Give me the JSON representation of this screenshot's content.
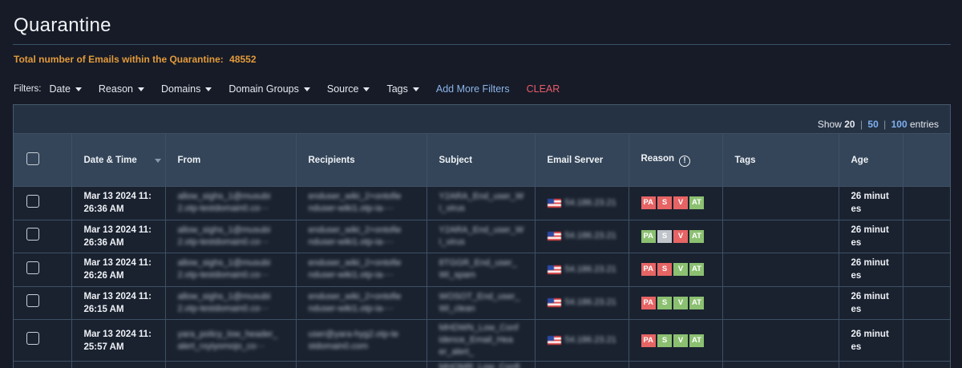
{
  "page": {
    "title": "Quarantine"
  },
  "summary": {
    "label": "Total number of Emails within the Quarantine:",
    "count": "48552"
  },
  "filters": {
    "label": "Filters:",
    "items": [
      "Date",
      "Reason",
      "Domains",
      "Domain Groups",
      "Source",
      "Tags"
    ],
    "add_more": "Add More Filters",
    "clear": "CLEAR"
  },
  "pagination": {
    "show": "Show",
    "opt20": "20",
    "opt50": "50",
    "opt100": "100",
    "sep": "|",
    "entries": "entries"
  },
  "table": {
    "headers": {
      "datetime": "Date & Time",
      "from": "From",
      "recipients": "Recipients",
      "subject": "Subject",
      "server": "Email Server",
      "reason": "Reason",
      "tags": "Tags",
      "age": "Age"
    },
    "rows": [
      {
        "date1": "Mar 13 2024 11:",
        "date2": "26:36 AM",
        "from1": "allow_sighs_1@musubi",
        "from2": "2.otp-testdomain0.co···",
        "rcpt1": "enduser_wiki_2+ontofie",
        "rcpt2": "nduser-wiki1.otp-ia-···",
        "subj1": "Y2ARA_End_user_W",
        "subj2": "I_virus",
        "server": "54.186.23.21",
        "age1": "26 minut",
        "age2": "es",
        "badges": [
          {
            "t": "PA",
            "c": "red"
          },
          {
            "t": "S",
            "c": "red"
          },
          {
            "t": "V",
            "c": "red"
          },
          {
            "t": "AT",
            "c": "green"
          }
        ]
      },
      {
        "date1": "Mar 13 2024 11:",
        "date2": "26:36 AM",
        "from1": "allow_sighs_1@musubi",
        "from2": "2.otp-testdomain0.co···",
        "rcpt1": "enduser_wiki_2+ontofie",
        "rcpt2": "nduser-wiki1.otp-ia-···",
        "subj1": "Y2ARA_End_user_W",
        "subj2": "I_virus",
        "server": "54.186.23.21",
        "age1": "26 minut",
        "age2": "es",
        "badges": [
          {
            "t": "PA",
            "c": "green"
          },
          {
            "t": "S",
            "c": "grey"
          },
          {
            "t": "V",
            "c": "red"
          },
          {
            "t": "AT",
            "c": "green"
          }
        ]
      },
      {
        "date1": "Mar 13 2024 11:",
        "date2": "26:26 AM",
        "from1": "allow_sighs_1@musubi",
        "from2": "2.otp-testdomain0.co···",
        "rcpt1": "enduser_wiki_2+ontofie",
        "rcpt2": "nduser-wiki1.otp-ia-···",
        "subj1": "8TGGR_End_user_",
        "subj2": "Wi_spam",
        "server": "54.186.23.21",
        "age1": "26 minut",
        "age2": "es",
        "badges": [
          {
            "t": "PA",
            "c": "red"
          },
          {
            "t": "S",
            "c": "red"
          },
          {
            "t": "V",
            "c": "green"
          },
          {
            "t": "AT",
            "c": "green"
          }
        ]
      },
      {
        "date1": "Mar 13 2024 11:",
        "date2": "26:15 AM",
        "from1": "allow_sighs_1@musubi",
        "from2": "2.otp-testdomain0.co···",
        "rcpt1": "enduser_wiki_2+ontofie",
        "rcpt2": "nduser-wiki1.otp-ia-···",
        "subj1": "WOSOT_End_user_",
        "subj2": "Wi_clean",
        "server": "54.186.23.21",
        "age1": "26 minut",
        "age2": "es",
        "badges": [
          {
            "t": "PA",
            "c": "red"
          },
          {
            "t": "S",
            "c": "green"
          },
          {
            "t": "V",
            "c": "green"
          },
          {
            "t": "AT",
            "c": "green"
          }
        ]
      },
      {
        "date1": "Mar 13 2024 11:",
        "date2": "25:57 AM",
        "from1": "yara_policy_low_header_",
        "from2": "alert_rxyiyomojo_co···",
        "rcpt1": "user@yara-hyg2.otp-te",
        "rcpt2": "stdomain0.com",
        "subj1": "MHDWN_Low_Conf",
        "subj2": "idence_Email_Hea",
        "subj3": "er_alert_",
        "server": "54.186.23.21",
        "age1": "26 minut",
        "age2": "es",
        "badges": [
          {
            "t": "PA",
            "c": "red"
          },
          {
            "t": "S",
            "c": "green"
          },
          {
            "t": "V",
            "c": "green"
          },
          {
            "t": "AT",
            "c": "green"
          }
        ]
      }
    ],
    "partial_row": {
      "subj1": "MHQMR_Low_Confi"
    }
  },
  "colors": {
    "accent_orange": "#e39a3b",
    "link_blue": "#7fb0f0",
    "clear_red": "#e95b6b",
    "badge_red": "#e66464",
    "badge_green": "#8bc071",
    "badge_grey": "#bfc4ca"
  }
}
